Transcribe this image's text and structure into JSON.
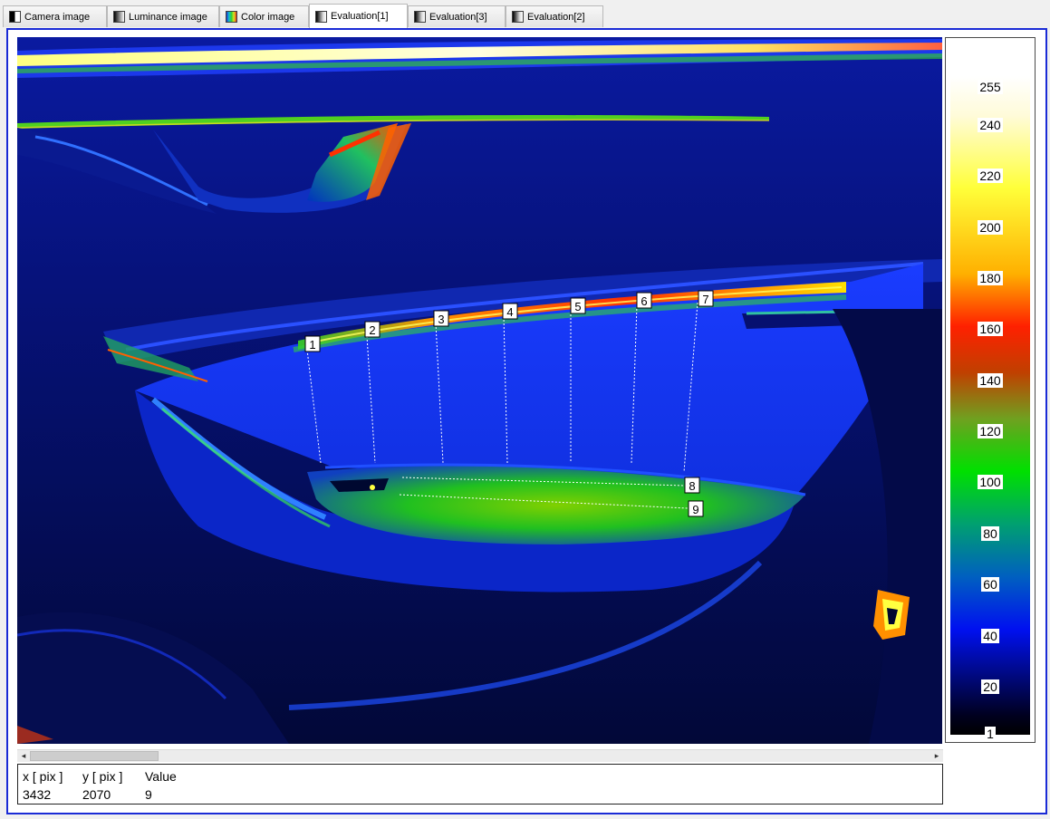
{
  "tabs": [
    {
      "label": "Camera image",
      "icon": "camera-image-icon",
      "active": false
    },
    {
      "label": "Luminance image",
      "icon": "luminance-image-icon",
      "active": false
    },
    {
      "label": "Color image",
      "icon": "color-image-icon",
      "active": false
    },
    {
      "label": "Evaluation[1]",
      "icon": "evaluation-icon",
      "active": true
    },
    {
      "label": "Evaluation[3]",
      "icon": "evaluation-icon",
      "active": false
    },
    {
      "label": "Evaluation[2]",
      "icon": "evaluation-icon",
      "active": false
    }
  ],
  "image": {
    "description_icon": "false-color-heatmap",
    "markers": [
      "1",
      "2",
      "3",
      "4",
      "5",
      "6",
      "7",
      "8",
      "9"
    ]
  },
  "scale": {
    "ticks": [
      "255",
      "240",
      "220",
      "200",
      "180",
      "160",
      "140",
      "120",
      "100",
      "80",
      "60",
      "40",
      "20",
      "1"
    ]
  },
  "scrollbar": {
    "left_arrow": "◂",
    "right_arrow": "▸"
  },
  "info": {
    "headers": {
      "x": "x [ pix ]",
      "y": "y [ pix ]",
      "value": "Value"
    },
    "values": {
      "x": "3432",
      "y": "2070",
      "value": "9"
    }
  },
  "colors": {
    "frame_border": "#1a2bd6",
    "background": "#f0f0f0"
  }
}
